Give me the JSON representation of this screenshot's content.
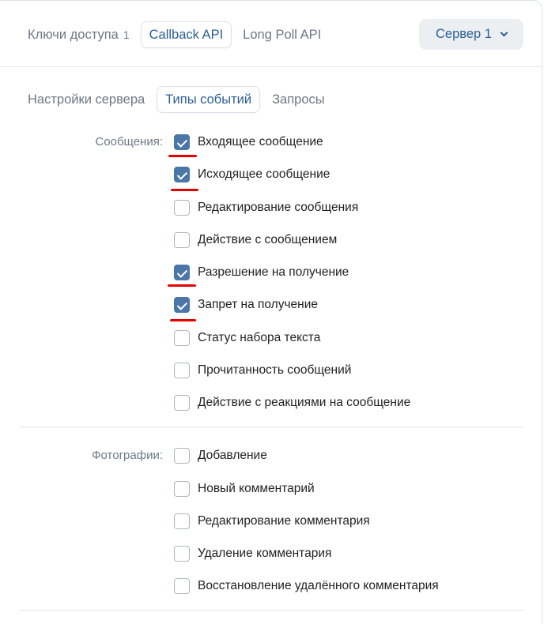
{
  "top_tabs": [
    {
      "label": "Ключи доступа",
      "counter": "1"
    },
    {
      "label": "Callback API"
    },
    {
      "label": "Long Poll API"
    }
  ],
  "server_select": {
    "label": "Сервер 1"
  },
  "sub_tabs": [
    {
      "label": "Настройки сервера"
    },
    {
      "label": "Типы событий"
    },
    {
      "label": "Запросы"
    }
  ],
  "groups": [
    {
      "label": "Сообщения:",
      "items": [
        {
          "label": "Входящее сообщение",
          "checked": true
        },
        {
          "label": "Исходящее сообщение",
          "checked": true
        },
        {
          "label": "Редактирование сообщения",
          "checked": false
        },
        {
          "label": "Действие с сообщением",
          "checked": false
        },
        {
          "label": "Разрешение на получение",
          "checked": true
        },
        {
          "label": "Запрет на получение",
          "checked": true
        },
        {
          "label": "Статус набора текста",
          "checked": false
        },
        {
          "label": "Прочитанность сообщений",
          "checked": false
        },
        {
          "label": "Действие с реакциями на сообщение",
          "checked": false
        }
      ]
    },
    {
      "label": "Фотографии:",
      "items": [
        {
          "label": "Добавление",
          "checked": false
        },
        {
          "label": "Новый комментарий",
          "checked": false
        },
        {
          "label": "Редактирование комментария",
          "checked": false
        },
        {
          "label": "Удаление комментария",
          "checked": false
        },
        {
          "label": "Восстановление удалённого комментария",
          "checked": false
        }
      ]
    }
  ],
  "colors": {
    "accent": "#4a76a8",
    "link": "#2c5f95",
    "annotation": "#e60000"
  }
}
